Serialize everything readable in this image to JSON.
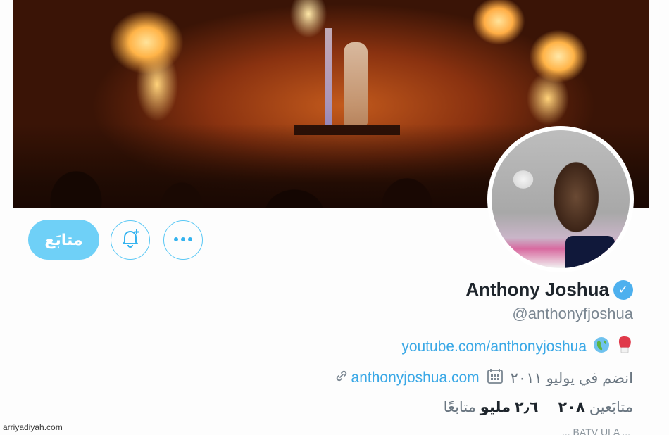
{
  "profile": {
    "name": "Anthony Joshua",
    "handle": "@anthonyfjoshua",
    "bio_link": "youtube.com/anthonyjoshua",
    "website": "anthonyjoshua.com",
    "joined": "انضم في يوليو ٢٠١١",
    "following_count": "٢٠٨",
    "following_label": "متابَعين",
    "followers_count": "٢٫٦ مليو",
    "followers_label": "متابعًا",
    "follow_label": "متابَع",
    "partial_line": "... BATV ULA ..."
  },
  "icons": {
    "verified": "verified-check-icon",
    "notify": "bell-plus-icon",
    "more": "ellipsis-icon",
    "globe": "globe-icon",
    "glove": "boxing-glove-icon",
    "link": "link-icon",
    "calendar": "calendar-icon"
  },
  "colors": {
    "accent": "#4db0ee",
    "follow_bg": "#6fd0f7",
    "link": "#3aa8e6",
    "text": "#1e252c",
    "muted": "#6a7681"
  },
  "watermark": "arriyadiyah.com"
}
